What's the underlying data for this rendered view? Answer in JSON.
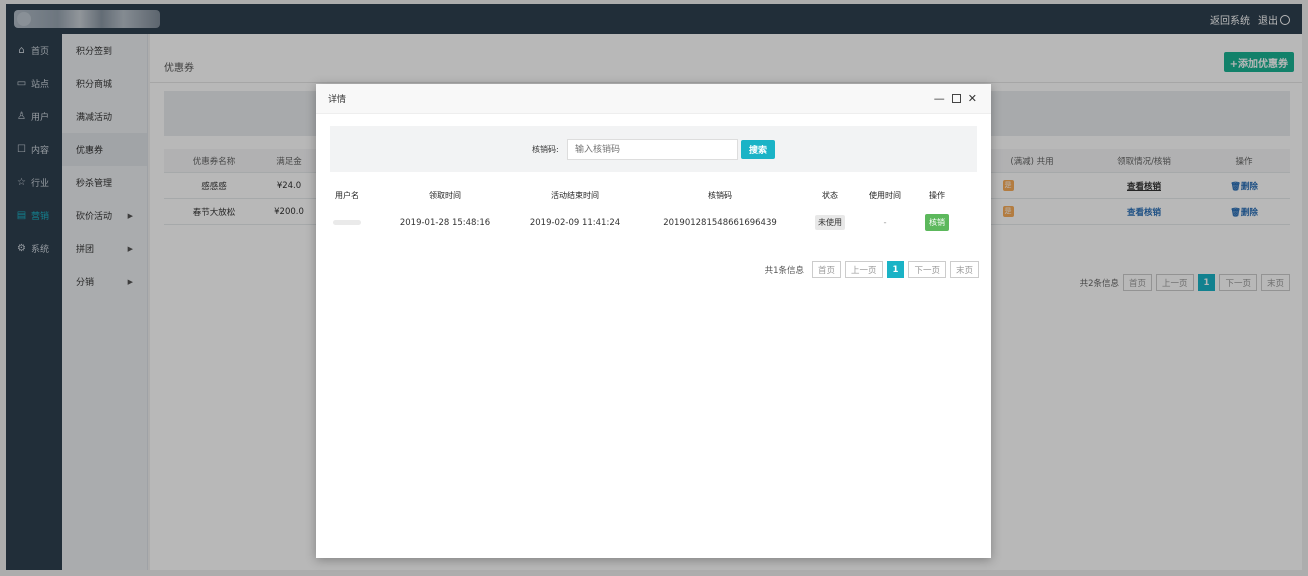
{
  "header": {
    "return_label": "返回系统",
    "logout_label": "退出"
  },
  "nav": [
    {
      "icon": "home-icon",
      "glyph": "⌂",
      "label": "首页"
    },
    {
      "icon": "monitor-icon",
      "glyph": "▭",
      "label": "站点"
    },
    {
      "icon": "user-icon",
      "glyph": "♙",
      "label": "用户"
    },
    {
      "icon": "message-icon",
      "glyph": "☐",
      "label": "内容"
    },
    {
      "icon": "star-icon",
      "glyph": "☆",
      "label": "行业"
    },
    {
      "icon": "marketing-icon",
      "glyph": "▤",
      "label": "营销"
    },
    {
      "icon": "gear-icon",
      "glyph": "⚙",
      "label": "系统"
    }
  ],
  "subnav": [
    {
      "label": "积分签到"
    },
    {
      "label": "积分商城"
    },
    {
      "label": "满减活动"
    },
    {
      "label": "优惠券"
    },
    {
      "label": "秒杀管理"
    },
    {
      "label": "砍价活动"
    },
    {
      "label": "拼团"
    },
    {
      "label": "分销"
    }
  ],
  "page": {
    "title": "优惠券",
    "add_button": "+添加优惠券"
  },
  "bg_table": {
    "headers": [
      "优惠券名称",
      "满足金",
      "(满减) 共用",
      "领取情况/核销",
      "操作"
    ],
    "rows": [
      {
        "name": "感感感",
        "amount": "¥24.0",
        "shared": "是",
        "view": "查看核销",
        "delete": "删除"
      },
      {
        "name": "春节大放松",
        "amount": "¥200.0",
        "shared": "是",
        "view": "查看核销",
        "delete": "删除"
      }
    ]
  },
  "bg_pager": {
    "total": "共2条信息",
    "first": "首页",
    "prev": "上一页",
    "current": "1",
    "next": "下一页",
    "last": "末页"
  },
  "modal": {
    "title": "详情",
    "search_label": "核销码:",
    "search_placeholder": "输入核销码",
    "search_button": "搜索",
    "headers": [
      "用户名",
      "领取时间",
      "活动结束时间",
      "核销码",
      "状态",
      "使用时间",
      "操作"
    ],
    "rows": [
      {
        "user": "",
        "received": "2019-01-28 15:48:16",
        "end": "2019-02-09 11:41:24",
        "code": "20190128154866169643​9",
        "status": "未使用",
        "used_time": "-",
        "action": "核销"
      }
    ],
    "pager": {
      "total": "共1条信息",
      "first": "首页",
      "prev": "上一页",
      "current": "1",
      "next": "下一页",
      "last": "末页"
    }
  }
}
